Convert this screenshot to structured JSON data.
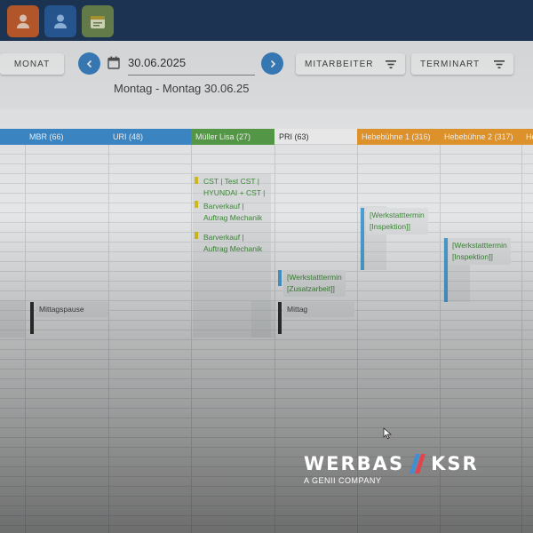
{
  "toolbar": {
    "monat_label": "MONAT",
    "date_value": "30.06.2025",
    "date_range": "Montag - Montag 30.06.25",
    "mitarbeiter_label": "MITARBEITER",
    "terminart_label": "TERMINART"
  },
  "resources": [
    {
      "label": "MBR (66)",
      "color": "#3f8fd2"
    },
    {
      "label": "URI (48)",
      "color": "#3f8fd2"
    },
    {
      "label": "Müller Lisa (27)",
      "color": "#5aa34c"
    },
    {
      "label": "PRI (63)",
      "color": "#fafafa"
    },
    {
      "label": "Hebebühne 1 (316)",
      "color": "#ef9d2e"
    },
    {
      "label": "Hebebühne 2 (317)",
      "color": "#ef9d2e"
    },
    {
      "label": "He",
      "color": "#ef9d2e"
    }
  ],
  "appointments": {
    "mueller_1": "CST | Test CST |\nHYUNDAI + CST |",
    "mueller_2": "Barverkauf |\nAuftrag Mechanik",
    "mueller_3": "Barverkauf |\nAuftrag Mechanik",
    "hb1": "[Werkstatttermin\n[Inspektion]]",
    "hb2": "[Werkstatttermin\n[Inspektion]]",
    "pri_1": "[Werkstatttermin\n[Zusatzarbeit]]",
    "pri_2": "Mittag",
    "mbr": "Mittagspause"
  },
  "logo": {
    "left": "WERBAS",
    "right": "KSR",
    "sub": "A GENII COMPANY"
  },
  "colors": {
    "topbar": "#1f3a5c",
    "accent": "#3c84c6"
  }
}
